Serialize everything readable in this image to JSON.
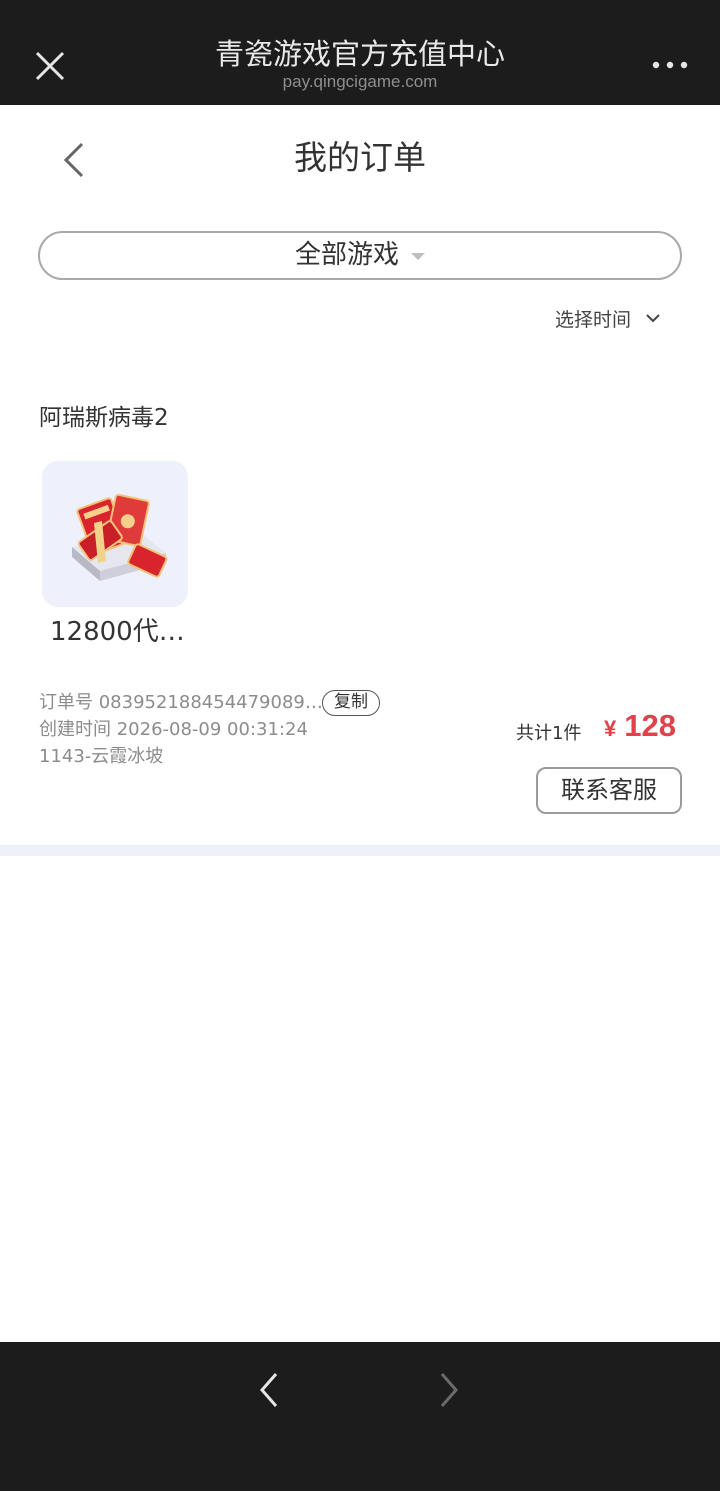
{
  "browser": {
    "title": "青瓷游戏官方充值中心",
    "url": "pay.qingcigame.com",
    "close_icon": "close-icon",
    "more_icon": "more-icon"
  },
  "header": {
    "title": "我的订单",
    "back_icon": "chevron-left-icon"
  },
  "filters": {
    "game": "全部游戏",
    "time": "选择时间"
  },
  "order": {
    "game_name": "阿瑞斯病毒2",
    "product_name": "12800代…",
    "order_no": "订单号 083952188454479089…",
    "copy_label": "复制",
    "created": "创建时间 2026-08-09 00:31:24",
    "server": "1143-云霞冰坡",
    "total": "共计1件",
    "currency": "¥",
    "amount": "128",
    "service_label": "联系客服"
  },
  "colors": {
    "bar_bg": "#1c1c1c",
    "price": "#e0414a",
    "thumb_bg": "#eef0fc",
    "divider": "#eef0f7"
  }
}
